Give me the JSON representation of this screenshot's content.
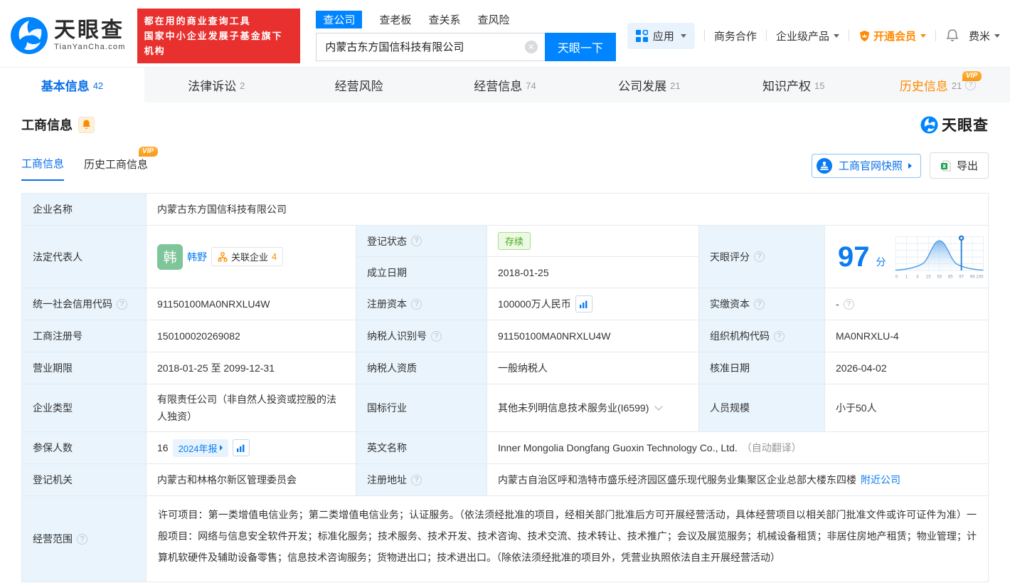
{
  "colors": {
    "accent": "#0084ff",
    "orange": "#ff8a00",
    "banner_red": "#e8312f",
    "green_tag": "#49a81d",
    "label_bg": "#e9f4fc"
  },
  "brand": {
    "logo_title": "天眼查",
    "logo_subtitle": "TianYanCha.com",
    "banner_line1": "都在用的商业查询工具",
    "banner_line2": "国家中小企业发展子基金旗下机构",
    "watermark": "天眼查"
  },
  "search": {
    "tabs": [
      "查公司",
      "查老板",
      "查关系",
      "查风险"
    ],
    "value": "内蒙古东方国信科技有限公司",
    "button": "天眼一下"
  },
  "topmenu": {
    "apps": "应用",
    "cooperation": "商务合作",
    "enterprise": "企业级产品",
    "vip": "开通会员",
    "user": "费米"
  },
  "nav": {
    "tabs": [
      {
        "label": "基本信息",
        "count": "42"
      },
      {
        "label": "法律诉讼",
        "count": "2"
      },
      {
        "label": "经营风险",
        "count": ""
      },
      {
        "label": "经营信息",
        "count": "74"
      },
      {
        "label": "公司发展",
        "count": "21"
      },
      {
        "label": "知识产权",
        "count": "15"
      },
      {
        "label": "历史信息",
        "count": "21"
      }
    ]
  },
  "section": {
    "title": "工商信息",
    "subtab_current": "工商信息",
    "subtab_history": "历史工商信息",
    "vip_badge": "VIP",
    "snapshot_button": "工商官网快照",
    "export_button": "导出"
  },
  "fields": {
    "company_name": {
      "label": "企业名称",
      "value": "内蒙古东方国信科技有限公司"
    },
    "legal_rep": {
      "label": "法定代表人",
      "avatar": "韩",
      "name": "韩野",
      "related_label": "关联企业",
      "related_count": "4"
    },
    "reg_status": {
      "label": "登记状态",
      "value": "存续"
    },
    "est_date": {
      "label": "成立日期",
      "value": "2018-01-25"
    },
    "score": {
      "label": "天眼评分",
      "value": "97",
      "unit": "分"
    },
    "credit_code": {
      "label": "统一社会信用代码",
      "value": "91150100MA0NRXLU4W"
    },
    "reg_capital": {
      "label": "注册资本",
      "value": "100000万人民币"
    },
    "paid_capital": {
      "label": "实缴资本",
      "value": "-"
    },
    "reg_number": {
      "label": "工商注册号",
      "value": "150100020269082"
    },
    "taxpayer_id": {
      "label": "纳税人识别号",
      "value": "91150100MA0NRXLU4W"
    },
    "org_code": {
      "label": "组织机构代码",
      "value": "MA0NRXLU-4"
    },
    "business_term": {
      "label": "营业期限",
      "value": "2018-01-25 至 2099-12-31"
    },
    "taxpayer_quality": {
      "label": "纳税人资质",
      "value": "一般纳税人"
    },
    "approval_date": {
      "label": "核准日期",
      "value": "2026-04-02"
    },
    "company_type": {
      "label": "企业类型",
      "value": "有限责任公司（非自然人投资或控股的法人独资）"
    },
    "industry": {
      "label": "国标行业",
      "value": "其他未列明信息技术服务业(I6599)"
    },
    "staff_size": {
      "label": "人员规模",
      "value": "小于50人"
    },
    "insured_count": {
      "label": "参保人数",
      "value": "16",
      "badge": "2024年报"
    },
    "english_name": {
      "label": "英文名称",
      "value": "Inner Mongolia Dongfang Guoxin Technology Co., Ltd.",
      "note": "（自动翻译）"
    },
    "reg_authority": {
      "label": "登记机关",
      "value": "内蒙古和林格尔新区管理委员会"
    },
    "reg_address": {
      "label": "注册地址",
      "value": "内蒙古自治区呼和浩特市盛乐经济园区盛乐现代服务业集聚区企业总部大楼东四楼",
      "link": "附近公司"
    },
    "business_scope": {
      "label": "经营范围",
      "value": "许可项目：第一类增值电信业务；第二类增值电信业务；认证服务。（依法须经批准的项目，经相关部门批准后方可开展经营活动，具体经营项目以相关部门批准文件或许可证件为准）一般项目：网络与信息安全软件开发；标准化服务；技术服务、技术开发、技术咨询、技术交流、技术转让、技术推广；会议及展览服务；机械设备租赁；非居住房地产租赁；物业管理；计算机软硬件及辅助设备零售；信息技术咨询服务；货物进出口；技术进出口。（除依法须经批准的项目外，凭营业执照依法自主开展经营活动）"
    }
  },
  "chart_data": {
    "type": "area",
    "description": "天眼评分 score distribution bell curve with marker pin at company score",
    "x_tick_labels": [
      "0",
      "1",
      "3",
      "15",
      "50",
      "85",
      "97",
      "99",
      "100"
    ],
    "curve_peak_at": "50",
    "marker_value": "97",
    "score": 97,
    "grid": true
  }
}
